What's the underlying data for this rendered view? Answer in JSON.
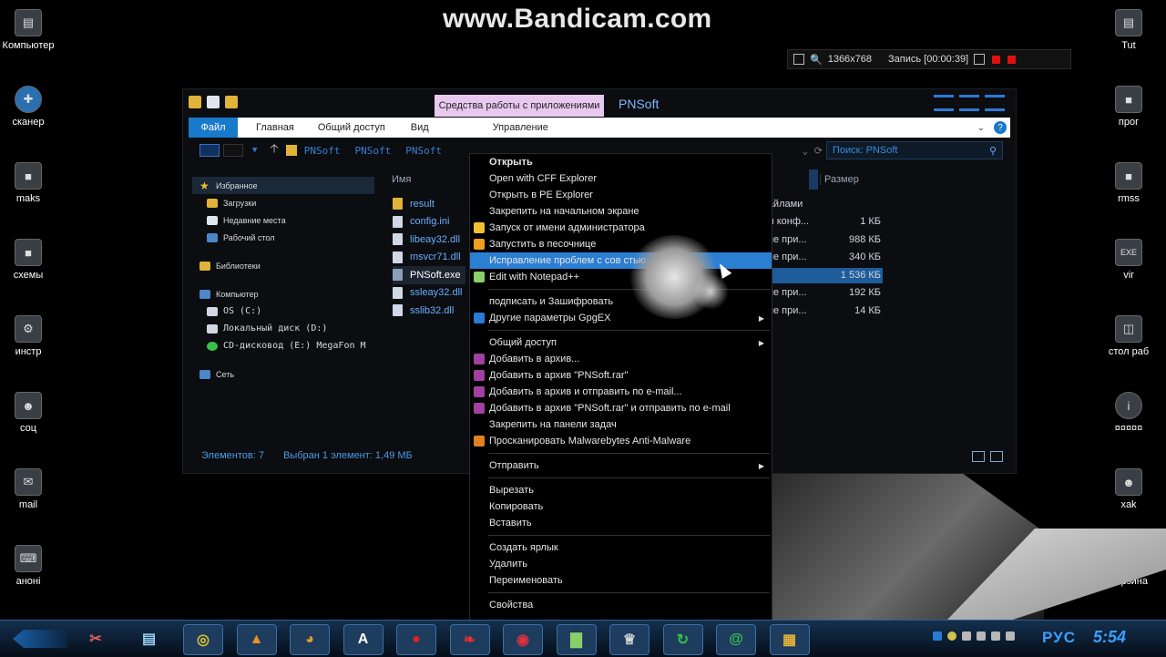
{
  "watermark": "www.Bandicam.com",
  "recorder": {
    "resolution": "1366x768",
    "status": "Запись [00:00:39]"
  },
  "desktop_left": [
    "Компьютер",
    "сканер",
    "maks",
    "схемы",
    "инстр",
    "соц",
    "mail",
    "аноні"
  ],
  "desktop_right": [
    "Tut",
    "прог",
    "rmss",
    "vir",
    "стол раб",
    "¤¤¤¤¤",
    "xak",
    "Корзина"
  ],
  "window": {
    "context_tab": "Средства работы с приложениями",
    "title": "PNSoft",
    "ribbon": {
      "file": "Файл",
      "home": "Главная",
      "share": "Общий доступ",
      "view": "Вид",
      "manage": "Управление"
    },
    "address": [
      "PNSoft",
      "PNSoft",
      "PNSoft"
    ],
    "search_placeholder": "Поиск: PNSoft",
    "nav": {
      "favorites": "Избранное",
      "downloads": "Загрузки",
      "recent": "Недавние места",
      "desktop": "Рабочий стол",
      "libraries": "Библиотеки",
      "computer": "Компьютер",
      "drive_c": "OS (C:)",
      "drive_d": "Локальный диск (D:)",
      "drive_e": "CD-дисковод (E:) MegaFon M",
      "network": "Сеть"
    },
    "columns": {
      "name": "Имя",
      "size": "Размер"
    },
    "files": [
      {
        "name": "result",
        "type": "Папка с файлами",
        "size": ""
      },
      {
        "name": "config.ini",
        "type": "Параметры конф...",
        "size": "1 КБ"
      },
      {
        "name": "libeay32.dll",
        "type": "Расширение при...",
        "size": "988 КБ"
      },
      {
        "name": "msvcr71.dll",
        "type": "Расширение при...",
        "size": "340 КБ"
      },
      {
        "name": "PNSoft.exe",
        "type": "ние",
        "size": "1 536 КБ"
      },
      {
        "name": "ssleay32.dll",
        "type": "Расширение при...",
        "size": "192 КБ"
      },
      {
        "name": "sslib32.dll",
        "type": "Расширение при...",
        "size": "14 КБ"
      }
    ],
    "status_count": "Элементов: 7",
    "status_selected": "Выбран 1 элемент: 1,49 МБ"
  },
  "context_menu": [
    {
      "label": "Открыть",
      "bold": true
    },
    {
      "label": "Open with CFF Explorer"
    },
    {
      "label": "Открыть в PE Explorer"
    },
    {
      "label": "Закрепить на начальном экране"
    },
    {
      "label": "Запуск от имени администратора",
      "icon": "shield"
    },
    {
      "label": "Запустить в песочнице",
      "icon": "sandbox"
    },
    {
      "label": "Исправление проблем с сов      стью",
      "highlight": true
    },
    {
      "label": "Edit with Notepad++",
      "icon": "notepad"
    },
    {
      "sep": true
    },
    {
      "label": "подписать и Зашифровать"
    },
    {
      "label": "Другие параметры GpgEX",
      "icon": "gpg",
      "arrow": true
    },
    {
      "sep": true
    },
    {
      "label": "Общий доступ",
      "arrow": true
    },
    {
      "label": "Добавить в архив...",
      "icon": "rar"
    },
    {
      "label": "Добавить в архив \"PNSoft.rar\"",
      "icon": "rar"
    },
    {
      "label": "Добавить в архив и отправить по e-mail...",
      "icon": "rar"
    },
    {
      "label": "Добавить в архив \"PNSoft.rar\" и отправить по e-mail",
      "icon": "rar"
    },
    {
      "label": "Закрепить на панели задач"
    },
    {
      "label": "Просканировать Malwarebytes Anti-Malware",
      "icon": "mbam"
    },
    {
      "sep": true
    },
    {
      "label": "Отправить",
      "arrow": true
    },
    {
      "sep": true
    },
    {
      "label": "Вырезать"
    },
    {
      "label": "Копировать"
    },
    {
      "label": "Вставить"
    },
    {
      "sep": true
    },
    {
      "label": "Создать ярлык"
    },
    {
      "label": "Удалить"
    },
    {
      "label": "Переименовать"
    },
    {
      "sep": true
    },
    {
      "label": "Свойства"
    }
  ],
  "taskbar": {
    "apps": [
      "scissors-icon",
      "notes-icon",
      "chrome-icon",
      "avast-icon",
      "pizza-icon",
      "text-editor-icon",
      "record-icon",
      "chili-icon",
      "pdf-icon",
      "chart-icon",
      "wot-icon",
      "sync-icon",
      "mail-at-icon",
      "explorer-icon"
    ],
    "lang": "РУС",
    "clock": "5:54"
  },
  "colors": {
    "accent": "#2b7fd3",
    "folder": "#e2b33a",
    "context_tab": "#e9c8ef"
  }
}
